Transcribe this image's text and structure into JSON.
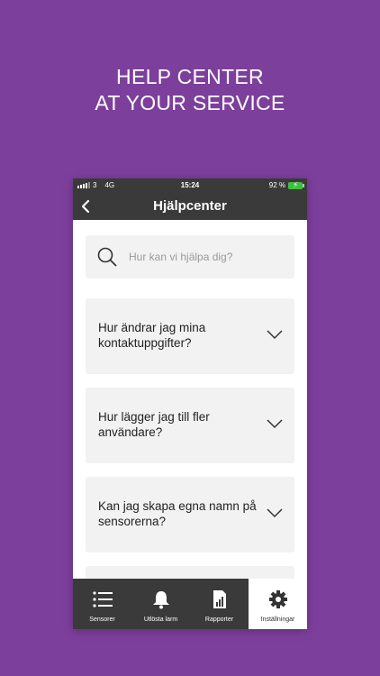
{
  "promo": {
    "line1": "HELP CENTER",
    "line2": "AT YOUR SERVICE"
  },
  "statusbar": {
    "carrier": "3",
    "network": "4G",
    "time": "15:24",
    "battery": "92 %"
  },
  "navbar": {
    "title": "Hjälpcenter",
    "back_icon": "chevron-left-icon"
  },
  "search": {
    "placeholder": "Hur kan vi hjälpa dig?"
  },
  "faq": [
    {
      "question": "Hur ändrar jag mina kontaktuppgifter?"
    },
    {
      "question": "Hur lägger jag till fler användare?"
    },
    {
      "question": "Kan jag skapa egna namn på sensorerna?"
    },
    {
      "question": ""
    }
  ],
  "tabs": [
    {
      "label": "Sensorer",
      "icon": "list-icon"
    },
    {
      "label": "Utlösta larm",
      "icon": "bell-icon"
    },
    {
      "label": "Rapporter",
      "icon": "report-icon"
    },
    {
      "label": "Inställningar",
      "icon": "gear-icon",
      "active": true
    }
  ],
  "colors": {
    "background": "#7d3f9c",
    "bar": "#3a3a3a",
    "card": "#f2f2f2",
    "battery": "#3fbf3f"
  }
}
